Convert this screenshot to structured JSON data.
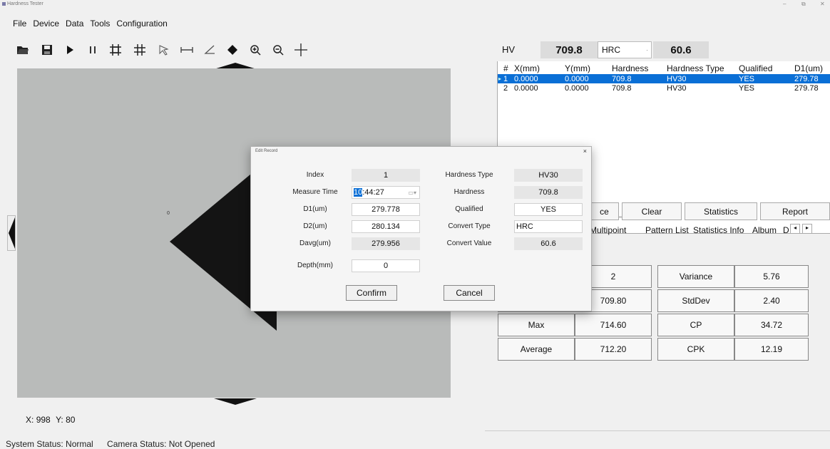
{
  "window": {
    "title": "Hardness Tester",
    "controls": [
      "–",
      "⧉",
      "✕"
    ]
  },
  "menu": [
    "File",
    "Device",
    "Data",
    "Tools",
    "Configuration"
  ],
  "toolbar": [
    "open-folder-icon",
    "save-icon",
    "play-icon",
    "pause-icon",
    "grid-box-icon",
    "grid-icon",
    "select-arrow-icon",
    "distance-icon",
    "angle-icon",
    "eraser-icon",
    "zoom-in-icon",
    "zoom-out-icon",
    "crosshair-icon"
  ],
  "toolbar_glyphs": [
    "🖿",
    "🖫",
    "▶",
    "❚❚",
    "⌗",
    "#",
    "⇖",
    "↦",
    "∠",
    "◆",
    "⊕",
    "⊖",
    "+"
  ],
  "coords": {
    "x_label": "X:",
    "x": "998",
    "y_label": "Y:",
    "y": "80"
  },
  "status": {
    "system": "System Status: Normal",
    "camera": "Camera Status: Not Opened"
  },
  "hv": {
    "label": "HV",
    "value": "709.8",
    "convert_type": "HRC",
    "convert_value": "60.6"
  },
  "table": {
    "headers": [
      "#",
      "X(mm)",
      "Y(mm)",
      "Hardness",
      "Hardness Type",
      "Qualified",
      "D1(um)"
    ],
    "rows": [
      [
        "1",
        "0.0000",
        "0.0000",
        "709.8",
        "HV30",
        "YES",
        "279.78"
      ],
      [
        "2",
        "0.0000",
        "0.0000",
        "709.8",
        "HV30",
        "YES",
        "279.78"
      ]
    ]
  },
  "actions": [
    "ce",
    "Clear",
    "Statistics",
    "Report"
  ],
  "tabs": [
    "Multipoint",
    "Pattern List",
    "Statistics Info",
    "Album",
    "D"
  ],
  "stats": [
    [
      "",
      "2",
      "Variance",
      "5.76"
    ],
    [
      "",
      "709.80",
      "StdDev",
      "2.40"
    ],
    [
      "Max",
      "714.60",
      "CP",
      "34.72"
    ],
    [
      "Average",
      "712.20",
      "CPK",
      "12.19"
    ]
  ],
  "dialog": {
    "title": "Edit Record",
    "close": "×",
    "index_label": "Index",
    "index": "1",
    "time_label": "Measure Time",
    "time_sel": "10",
    "time_rest": ":44:27",
    "d1_label": "D1(um)",
    "d1": "279.778",
    "d2_label": "D2(um)",
    "d2": "280.134",
    "davg_label": "Davg(um)",
    "davg": "279.956",
    "depth_label": "Depth(mm)",
    "depth": "0",
    "htype_label": "Hardness Type",
    "htype": "HV30",
    "hard_label": "Hardness",
    "hard": "709.8",
    "qual_label": "Qualified",
    "qual": "YES",
    "ctype_label": "Convert Type",
    "ctype": "HRC",
    "cval_label": "Convert Value",
    "cval": "60.6",
    "confirm": "Confirm",
    "cancel": "Cancel"
  }
}
